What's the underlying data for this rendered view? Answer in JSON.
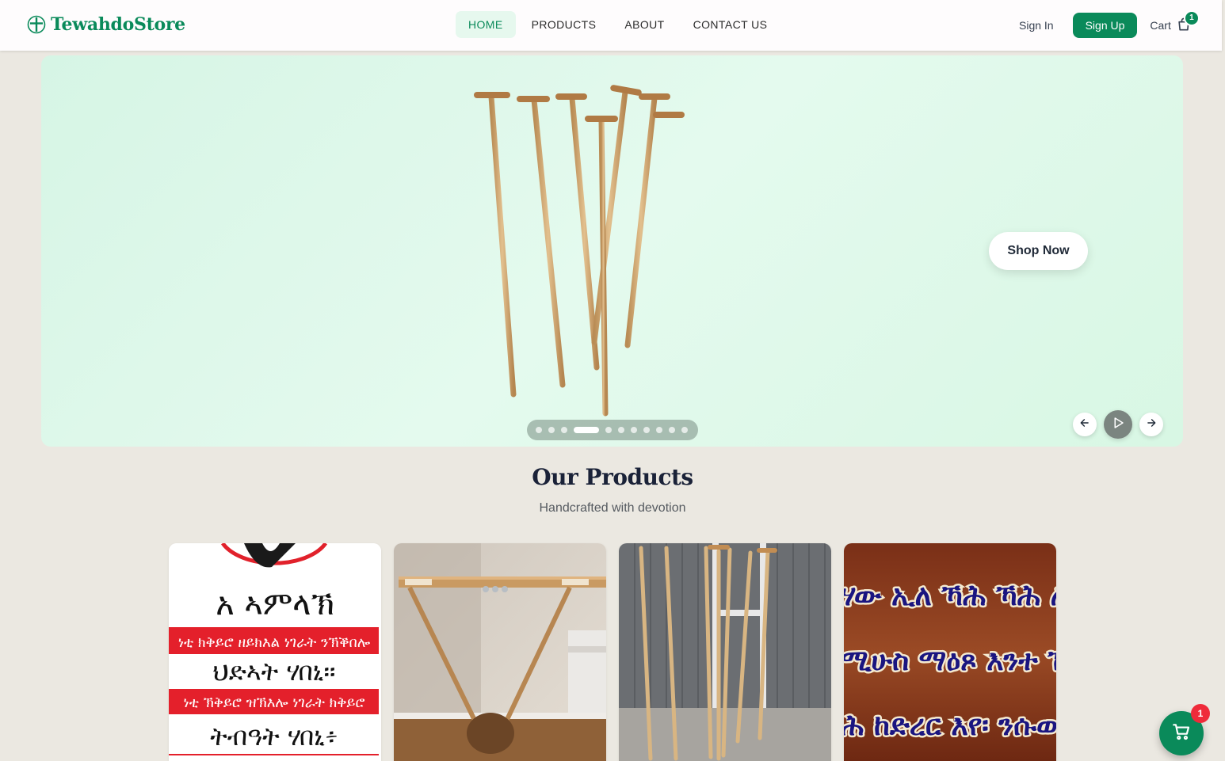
{
  "brand": {
    "name": "TewahdoStore",
    "accent": "#0a8a5a",
    "icon": "cross-icon"
  },
  "nav": {
    "items": [
      {
        "label": "HOME",
        "active": true
      },
      {
        "label": "PRODUCTS",
        "active": false
      },
      {
        "label": "ABOUT",
        "active": false
      },
      {
        "label": "CONTACT US",
        "active": false
      }
    ],
    "sign_in": "Sign In",
    "sign_up": "Sign Up",
    "cart_label": "Cart",
    "cart_count": "1"
  },
  "hero": {
    "cta": "Shop Now",
    "slide_count": 12,
    "active_slide": 4,
    "image": "wooden prayer staffs (mekomia)"
  },
  "products": {
    "title": "Our Products",
    "subtitle": "Handcrafted with devotion",
    "cards": [
      {
        "image": "ethiopic text poster",
        "text_lines": [
          "አ ኣምላኽ",
          "ነቲ ክቅይሮ ዘይክእል ነገራት ንኽቕበሎ",
          "ህድኣት ሃበኒ።",
          "ነቲ ኽቅይሮ ዝኽእሎ ነገራት ክቅይሮ",
          "ትብዓት ሃበኒ፥"
        ]
      },
      {
        "image": "wooden kebero stand"
      },
      {
        "image": "wooden staffs against fence"
      },
      {
        "image": "ethiopic calligraphy",
        "text_lines": [
          "ሃው ኢለ ኻሕ ኻሕ ሌብል",
          "ሚሁስ ማዕጾ እንተ ኸፈተ",
          "ሕ ከድረር እየ፡ ንሱውን ፀ"
        ]
      }
    ]
  },
  "floating_cart": {
    "count": "1",
    "icon": "cart-icon"
  }
}
